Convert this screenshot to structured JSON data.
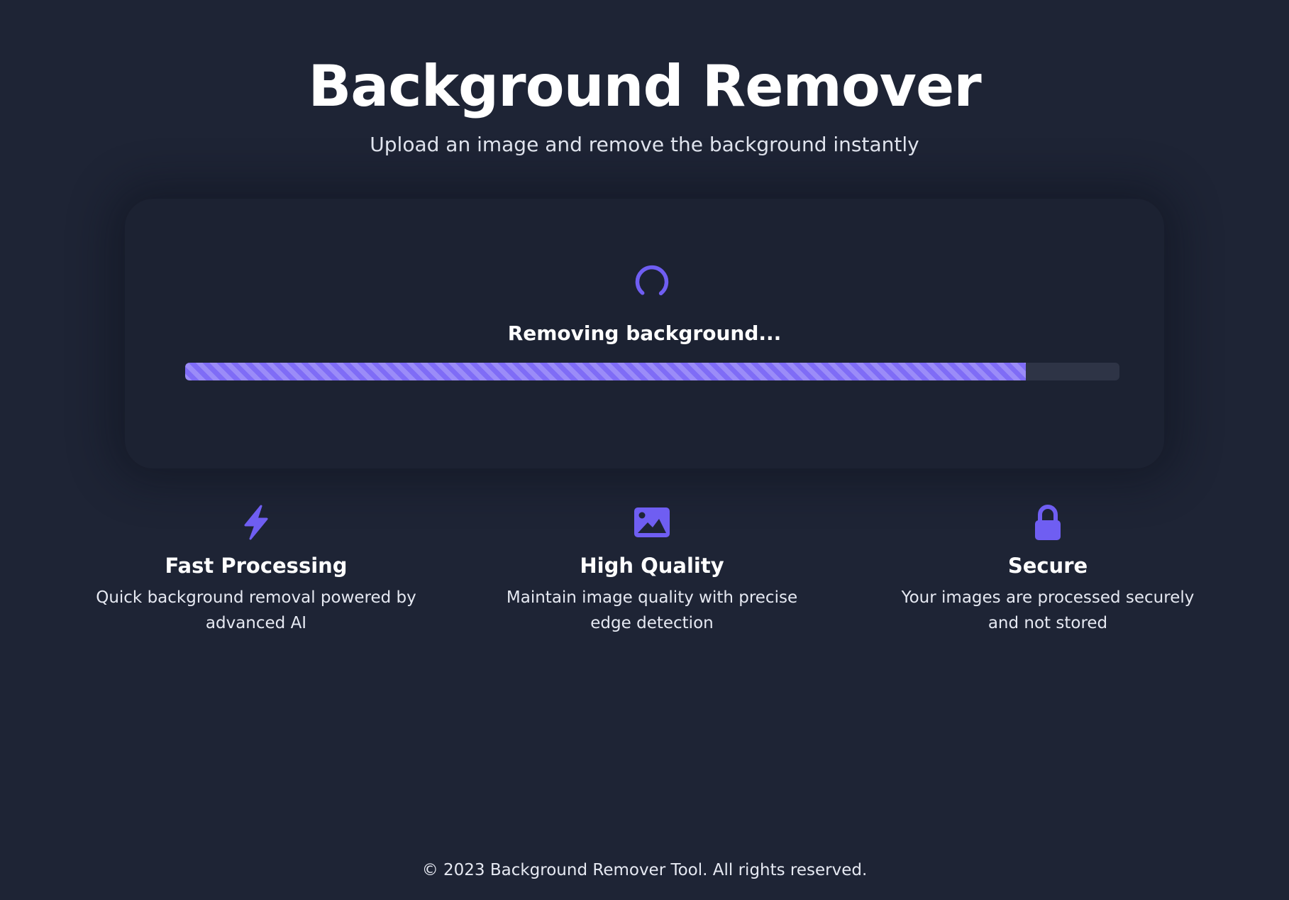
{
  "header": {
    "title": "Background Remover",
    "subtitle": "Upload an image and remove the background instantly"
  },
  "processing": {
    "spinner_icon": "loading-spinner-icon",
    "status_text": "Removing background...",
    "progress_fraction": 0.9
  },
  "features": [
    {
      "icon": "lightning-bolt-icon",
      "title": "Fast Processing",
      "description": "Quick background removal powered by advanced AI"
    },
    {
      "icon": "image-icon",
      "title": "High Quality",
      "description": "Maintain image quality with precise edge detection"
    },
    {
      "icon": "lock-icon",
      "title": "Secure",
      "description": "Your images are processed securely and not stored"
    }
  ],
  "footer": {
    "copyright": "© 2023 Background Remover Tool. All rights reserved."
  },
  "colors": {
    "background": "#1e2435",
    "accent": "#6f5ef2",
    "progress_fill": "#7f6cf6",
    "progress_track": "#2e3446"
  }
}
